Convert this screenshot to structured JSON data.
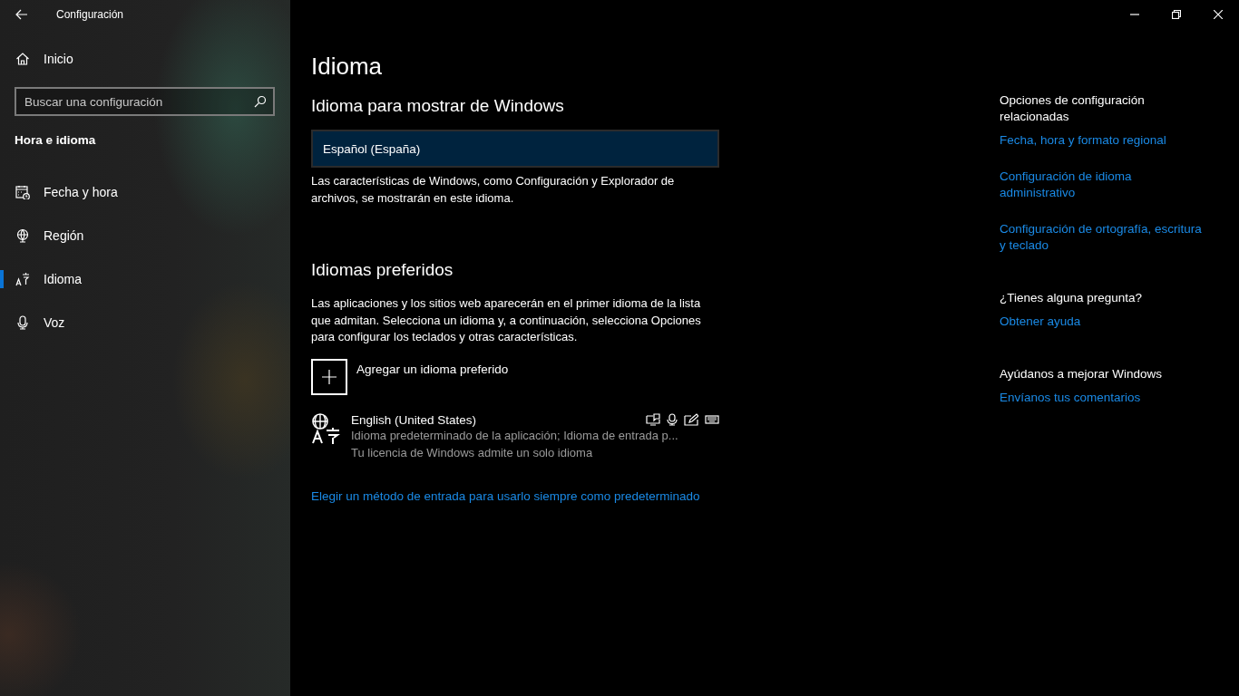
{
  "window": {
    "title": "Configuración"
  },
  "sidebar": {
    "home": "Inicio",
    "search": {
      "placeholder": "Buscar una configuración"
    },
    "section": "Hora e idioma",
    "items": [
      {
        "label": "Fecha y hora",
        "selected": false
      },
      {
        "label": "Región",
        "selected": false
      },
      {
        "label": "Idioma",
        "selected": true
      },
      {
        "label": "Voz",
        "selected": false
      }
    ]
  },
  "page": {
    "title": "Idioma",
    "display_language": {
      "heading": "Idioma para mostrar de Windows",
      "value": "Español (España)",
      "description": "Las características de Windows, como Configuración y Explorador de archivos, se mostrarán en este idioma."
    },
    "preferred": {
      "heading": "Idiomas preferidos",
      "description": "Las aplicaciones y los sitios web aparecerán en el primer idioma de la lista que admitan. Selecciona un idioma y, a continuación, selecciona Opciones para configurar los teclados y otras características.",
      "add_button": "Agregar un idioma preferido",
      "languages": [
        {
          "name": "English (United States)",
          "detail": "Idioma predeterminado de la aplicación; Idioma de entrada p...",
          "license": "Tu licencia de Windows admite un solo idioma"
        }
      ],
      "link": "Elegir un método de entrada para usarlo siempre como predeterminado"
    }
  },
  "related": [
    {
      "heading": "Opciones de configuración relacionadas",
      "links": [
        "Fecha, hora y formato regional",
        "Configuración de idioma administrativo",
        "Configuración de ortografía, escritura y teclado"
      ]
    },
    {
      "heading": "¿Tienes alguna pregunta?",
      "links": [
        "Obtener ayuda"
      ]
    },
    {
      "heading": "Ayúdanos a mejorar Windows",
      "links": [
        "Envíanos tus comentarios"
      ]
    }
  ]
}
